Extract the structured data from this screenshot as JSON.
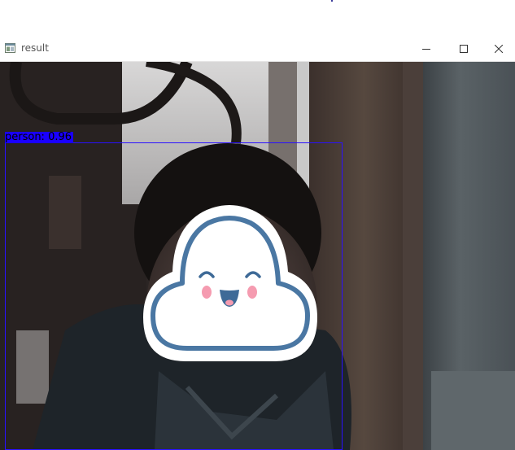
{
  "window": {
    "title": "result",
    "controls": {
      "minimize_icon": "minimize-icon",
      "maximize_icon": "maximize-icon",
      "close_icon": "close-icon"
    }
  },
  "detections": [
    {
      "label": "person: 0.96",
      "class": "person",
      "confidence": 0.96,
      "color": "#1a00ff"
    }
  ],
  "scene": {
    "overlay_sticker": "smiling-cloud-sticker",
    "sticker_outline_color": "#4a77a3",
    "sticker_cheek_color": "#f59bb0"
  }
}
